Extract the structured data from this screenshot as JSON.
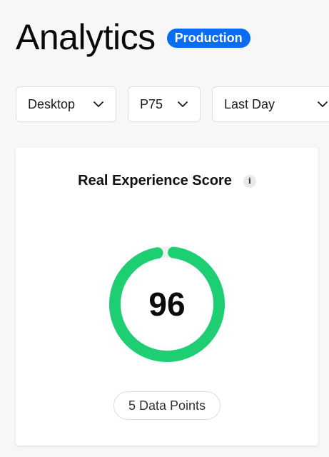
{
  "header": {
    "title": "Analytics",
    "environment_badge": "Production"
  },
  "filters": {
    "device": "Desktop",
    "percentile": "P75",
    "time_range": "Last Day"
  },
  "score_card": {
    "title": "Real Experience Score",
    "info_icon_label": "i",
    "score": 96,
    "score_max": 100,
    "data_points_label": "5 Data Points"
  },
  "colors": {
    "accent": "#0a6cf0",
    "gauge_good": "#1ece72",
    "gauge_track": "#eef0ef"
  }
}
